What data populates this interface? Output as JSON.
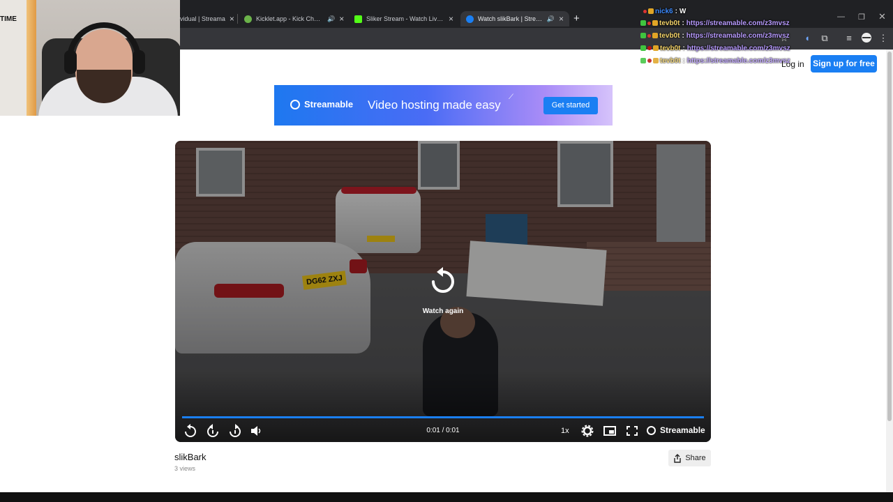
{
  "browser": {
    "tabs": [
      {
        "title": "vidual | Streama",
        "favicon_color": "#1a7ff3",
        "active": false
      },
      {
        "title": "Kicklet.app - Kick Chatbot",
        "favicon_color": "#6bb34a",
        "active": false
      },
      {
        "title": "Sliker Stream - Watch Live on K",
        "favicon_color": "#53fc18",
        "active": false
      },
      {
        "title": "Watch slikBark | Streamable",
        "favicon_color": "#1a7ff3",
        "active": true
      }
    ],
    "new_tab_icon": "plus-icon",
    "close_icon": "×"
  },
  "webcam": {
    "sign_text": "TIME"
  },
  "chat": {
    "lines": [
      {
        "user": "nick6",
        "message": "W",
        "link": false,
        "user_color": "#3d8bff"
      },
      {
        "user": "tevb0t",
        "message": "https://streamable.com/z3mvsz",
        "link": true,
        "user_color": "#f3d36a"
      },
      {
        "user": "tevb0t",
        "message": "https://streamable.com/z3mvsz",
        "link": true,
        "user_color": "#f3d36a"
      },
      {
        "user": "tevb0t",
        "message": "https://streamable.com/z3mvsz",
        "link": true,
        "user_color": "#f3d36a"
      },
      {
        "user": "tevb0t",
        "message": "https://streamable.com/z3mvsz",
        "link": true,
        "user_color": "#f3d36a"
      }
    ]
  },
  "header": {
    "login_label": "Log in",
    "signup_label": "Sign up for free"
  },
  "banner": {
    "brand": "Streamable",
    "tagline": "Video hosting made easy",
    "cta_label": "Get started"
  },
  "player": {
    "overlay_label": "Watch again",
    "time": "0:01 / 0:01",
    "progress": 1.0,
    "speed": "1x",
    "brand": "Streamable",
    "plate_text": "DG62 ZXJ"
  },
  "video": {
    "title": "slikBark",
    "views": "3 views",
    "share_label": "Share"
  },
  "colors": {
    "accent": "#1a7ff3",
    "chrome_dark": "#202124",
    "toolbar": "#35363a"
  }
}
